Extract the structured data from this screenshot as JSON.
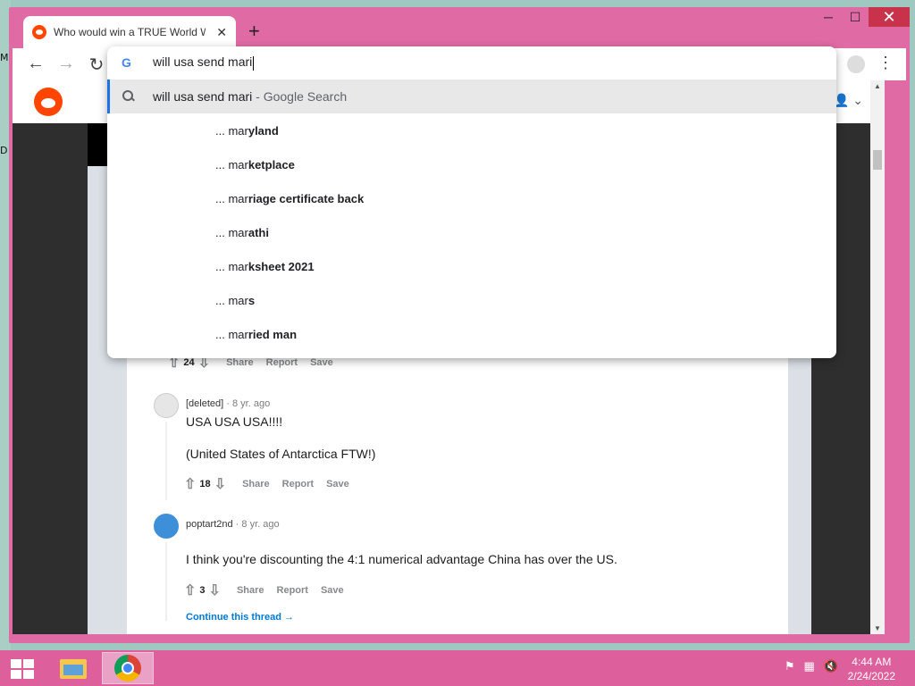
{
  "desktop": {
    "glyphs": [
      "M",
      "D"
    ]
  },
  "browser": {
    "tab_title": "Who would win a TRUE World War",
    "tab_close": "✕",
    "new_tab": "+",
    "window_controls": {
      "minimize": "─",
      "maximize": "☐",
      "close": "✕"
    },
    "nav": {
      "back": "←",
      "forward": "→",
      "reload": "↻"
    },
    "menu": "⋮"
  },
  "omnibox": {
    "engine_icon": "G",
    "input_value": "will usa send mari",
    "selected": {
      "text": "will usa send mari",
      "suffix": " - Google Search"
    },
    "suggestions": [
      {
        "prefix": "... mar",
        "completion": "yland"
      },
      {
        "prefix": "... mar",
        "completion": "ketplace"
      },
      {
        "prefix": "... mar",
        "completion": "riage certificate back"
      },
      {
        "prefix": "... mar",
        "completion": "athi"
      },
      {
        "prefix": "... mar",
        "completion": "ksheet 2021"
      },
      {
        "prefix": "... mar",
        "completion": "s"
      },
      {
        "prefix": "... mar",
        "completion": "ried man"
      }
    ]
  },
  "page": {
    "user_menu": "👤 ⌄",
    "comments": [
      {
        "votes": "24",
        "share": "Share",
        "report": "Report",
        "save": "Save"
      },
      {
        "author": "[deleted]",
        "time": "· 8 yr. ago",
        "lines": [
          "USA USA USA!!!!",
          "(United States of Antarctica FTW!)"
        ],
        "votes": "18",
        "share": "Share",
        "report": "Report",
        "save": "Save"
      },
      {
        "author": "poptart2nd",
        "time": "· 8 yr. ago",
        "lines": [
          "I think you're discounting the 4:1 numerical advantage China has over the US."
        ],
        "votes": "3",
        "share": "Share",
        "report": "Report",
        "save": "Save"
      }
    ],
    "continue_thread": "Continue this thread →"
  },
  "taskbar": {
    "time": "4:44 AM",
    "date": "2/24/2022"
  }
}
